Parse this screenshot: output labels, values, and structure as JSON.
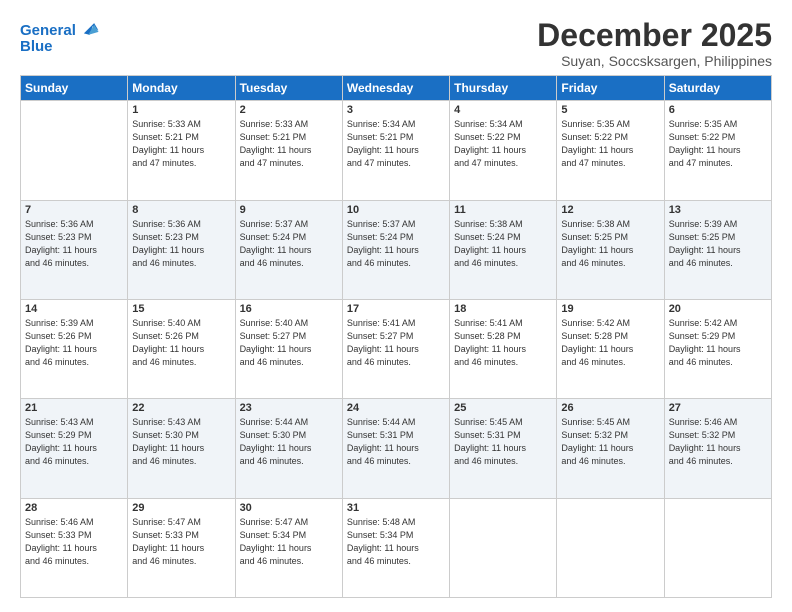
{
  "logo": {
    "line1": "General",
    "line2": "Blue"
  },
  "title": "December 2025",
  "subtitle": "Suyan, Soccsksargen, Philippines",
  "days_of_week": [
    "Sunday",
    "Monday",
    "Tuesday",
    "Wednesday",
    "Thursday",
    "Friday",
    "Saturday"
  ],
  "weeks": [
    [
      {
        "day": "",
        "info": ""
      },
      {
        "day": "1",
        "info": "Sunrise: 5:33 AM\nSunset: 5:21 PM\nDaylight: 11 hours\nand 47 minutes."
      },
      {
        "day": "2",
        "info": "Sunrise: 5:33 AM\nSunset: 5:21 PM\nDaylight: 11 hours\nand 47 minutes."
      },
      {
        "day": "3",
        "info": "Sunrise: 5:34 AM\nSunset: 5:21 PM\nDaylight: 11 hours\nand 47 minutes."
      },
      {
        "day": "4",
        "info": "Sunrise: 5:34 AM\nSunset: 5:22 PM\nDaylight: 11 hours\nand 47 minutes."
      },
      {
        "day": "5",
        "info": "Sunrise: 5:35 AM\nSunset: 5:22 PM\nDaylight: 11 hours\nand 47 minutes."
      },
      {
        "day": "6",
        "info": "Sunrise: 5:35 AM\nSunset: 5:22 PM\nDaylight: 11 hours\nand 47 minutes."
      }
    ],
    [
      {
        "day": "7",
        "info": "Sunrise: 5:36 AM\nSunset: 5:23 PM\nDaylight: 11 hours\nand 46 minutes."
      },
      {
        "day": "8",
        "info": "Sunrise: 5:36 AM\nSunset: 5:23 PM\nDaylight: 11 hours\nand 46 minutes."
      },
      {
        "day": "9",
        "info": "Sunrise: 5:37 AM\nSunset: 5:24 PM\nDaylight: 11 hours\nand 46 minutes."
      },
      {
        "day": "10",
        "info": "Sunrise: 5:37 AM\nSunset: 5:24 PM\nDaylight: 11 hours\nand 46 minutes."
      },
      {
        "day": "11",
        "info": "Sunrise: 5:38 AM\nSunset: 5:24 PM\nDaylight: 11 hours\nand 46 minutes."
      },
      {
        "day": "12",
        "info": "Sunrise: 5:38 AM\nSunset: 5:25 PM\nDaylight: 11 hours\nand 46 minutes."
      },
      {
        "day": "13",
        "info": "Sunrise: 5:39 AM\nSunset: 5:25 PM\nDaylight: 11 hours\nand 46 minutes."
      }
    ],
    [
      {
        "day": "14",
        "info": "Sunrise: 5:39 AM\nSunset: 5:26 PM\nDaylight: 11 hours\nand 46 minutes."
      },
      {
        "day": "15",
        "info": "Sunrise: 5:40 AM\nSunset: 5:26 PM\nDaylight: 11 hours\nand 46 minutes."
      },
      {
        "day": "16",
        "info": "Sunrise: 5:40 AM\nSunset: 5:27 PM\nDaylight: 11 hours\nand 46 minutes."
      },
      {
        "day": "17",
        "info": "Sunrise: 5:41 AM\nSunset: 5:27 PM\nDaylight: 11 hours\nand 46 minutes."
      },
      {
        "day": "18",
        "info": "Sunrise: 5:41 AM\nSunset: 5:28 PM\nDaylight: 11 hours\nand 46 minutes."
      },
      {
        "day": "19",
        "info": "Sunrise: 5:42 AM\nSunset: 5:28 PM\nDaylight: 11 hours\nand 46 minutes."
      },
      {
        "day": "20",
        "info": "Sunrise: 5:42 AM\nSunset: 5:29 PM\nDaylight: 11 hours\nand 46 minutes."
      }
    ],
    [
      {
        "day": "21",
        "info": "Sunrise: 5:43 AM\nSunset: 5:29 PM\nDaylight: 11 hours\nand 46 minutes."
      },
      {
        "day": "22",
        "info": "Sunrise: 5:43 AM\nSunset: 5:30 PM\nDaylight: 11 hours\nand 46 minutes."
      },
      {
        "day": "23",
        "info": "Sunrise: 5:44 AM\nSunset: 5:30 PM\nDaylight: 11 hours\nand 46 minutes."
      },
      {
        "day": "24",
        "info": "Sunrise: 5:44 AM\nSunset: 5:31 PM\nDaylight: 11 hours\nand 46 minutes."
      },
      {
        "day": "25",
        "info": "Sunrise: 5:45 AM\nSunset: 5:31 PM\nDaylight: 11 hours\nand 46 minutes."
      },
      {
        "day": "26",
        "info": "Sunrise: 5:45 AM\nSunset: 5:32 PM\nDaylight: 11 hours\nand 46 minutes."
      },
      {
        "day": "27",
        "info": "Sunrise: 5:46 AM\nSunset: 5:32 PM\nDaylight: 11 hours\nand 46 minutes."
      }
    ],
    [
      {
        "day": "28",
        "info": "Sunrise: 5:46 AM\nSunset: 5:33 PM\nDaylight: 11 hours\nand 46 minutes."
      },
      {
        "day": "29",
        "info": "Sunrise: 5:47 AM\nSunset: 5:33 PM\nDaylight: 11 hours\nand 46 minutes."
      },
      {
        "day": "30",
        "info": "Sunrise: 5:47 AM\nSunset: 5:34 PM\nDaylight: 11 hours\nand 46 minutes."
      },
      {
        "day": "31",
        "info": "Sunrise: 5:48 AM\nSunset: 5:34 PM\nDaylight: 11 hours\nand 46 minutes."
      },
      {
        "day": "",
        "info": ""
      },
      {
        "day": "",
        "info": ""
      },
      {
        "day": "",
        "info": ""
      }
    ]
  ]
}
